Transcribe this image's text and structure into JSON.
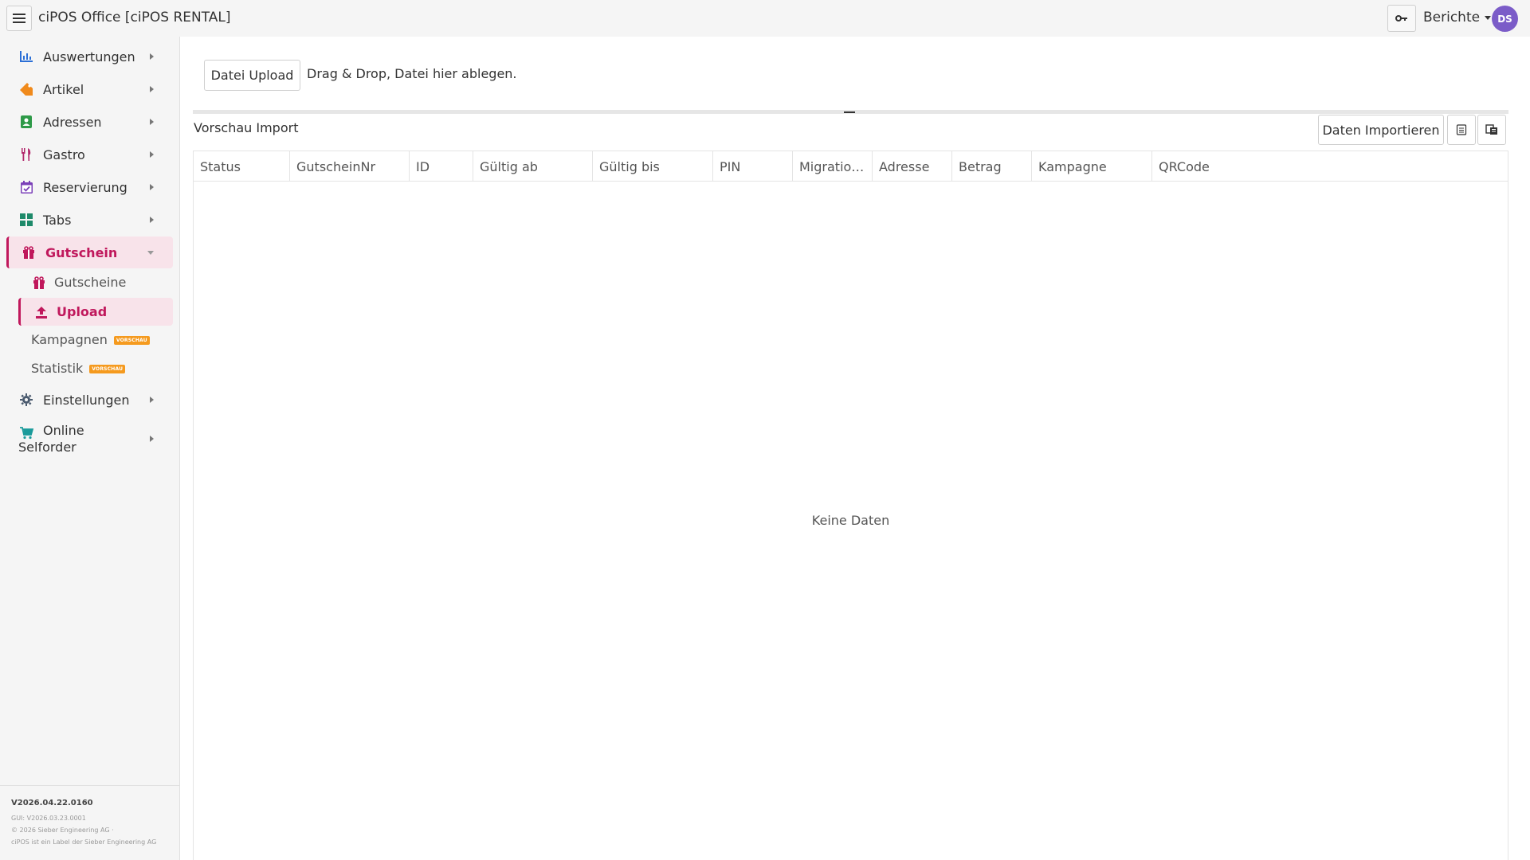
{
  "app": {
    "title": "ciPOS Office [ciPOS RENTAL]"
  },
  "header": {
    "reports_label": "Berichte",
    "avatar_initials": "DS"
  },
  "sidebar": {
    "items": [
      {
        "label": "Auswertungen",
        "icon": "bar-chart-icon"
      },
      {
        "label": "Artikel",
        "icon": "tag-icon"
      },
      {
        "label": "Adressen",
        "icon": "address-book-icon"
      },
      {
        "label": "Gastro",
        "icon": "cutlery-icon"
      },
      {
        "label": "Reservierung",
        "icon": "calendar-check-icon"
      },
      {
        "label": "Tabs",
        "icon": "grid-icon"
      },
      {
        "label": "Gutschein",
        "icon": "gift-icon"
      },
      {
        "label": "Einstellungen",
        "icon": "gear-icon"
      },
      {
        "label": "Online Selforder",
        "icon": "cart-icon"
      }
    ],
    "sub_items": [
      {
        "label": "Gutscheine",
        "icon": "gift-icon"
      },
      {
        "label": "Upload",
        "icon": "upload-icon"
      },
      {
        "label": "Kampagnen",
        "badge": "VORSCHAU"
      },
      {
        "label": "Statistik",
        "badge": "VORSCHAU"
      }
    ],
    "footer": {
      "version": "V2026.04.22.0160",
      "gui_version": "GUI: V2026.03.23.0001",
      "copyright": "© 2026 Sieber Engineering AG ·",
      "label_note": "ciPOS ist ein Label der Sieber Engineering AG"
    }
  },
  "main": {
    "upload_button": "Datei Upload",
    "drop_hint": "Drag & Drop, Datei hier ablegen.",
    "preview_title": "Vorschau Import",
    "import_button": "Daten Importieren",
    "columns": [
      "Status",
      "GutscheinNr",
      "ID",
      "Gültig ab",
      "Gültig bis",
      "PIN",
      "Migratio…",
      "Adresse",
      "Betrag",
      "Kampagne",
      "QRCode"
    ],
    "empty_text": "Keine Daten"
  },
  "colors": {
    "accent": "#c0185c",
    "accent_bg": "#f8e3ea",
    "avatar": "#7b5cc8",
    "badge": "#f59a1e"
  }
}
